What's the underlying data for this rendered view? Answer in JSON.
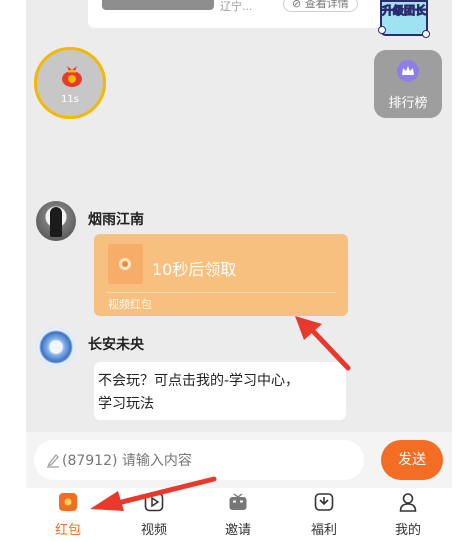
{
  "top_card": {
    "location_text": "辽宁...",
    "detail_link": "查看详情",
    "close_label": "×"
  },
  "badge": {
    "text": "升级团长"
  },
  "redpacket_timer": {
    "countdown": "11s"
  },
  "ranking": {
    "label": "排行榜"
  },
  "messages": [
    {
      "sender": "烟雨江南",
      "redpacket": {
        "status": "10秒后领取",
        "type": "视频红包"
      }
    },
    {
      "sender": "长安未央",
      "text_line1": "不会玩？可点击我的-学习中心，",
      "text_line2": "学习玩法"
    }
  ],
  "input": {
    "placeholder": "(87912) 请输入内容",
    "send_label": "发送"
  },
  "tabs": [
    {
      "label": "红包",
      "icon": "redpacket-icon",
      "active": true
    },
    {
      "label": "视频",
      "icon": "video-icon",
      "active": false
    },
    {
      "label": "邀请",
      "icon": "tv-icon",
      "active": false
    },
    {
      "label": "福利",
      "icon": "gift-icon",
      "active": false
    },
    {
      "label": "我的",
      "icon": "user-icon",
      "active": false
    }
  ],
  "colors": {
    "accent": "#f36e24",
    "redpacket_bubble": "#f7c07e",
    "timer_ring": "#f5b700",
    "annotation_arrow": "#e8392c"
  }
}
